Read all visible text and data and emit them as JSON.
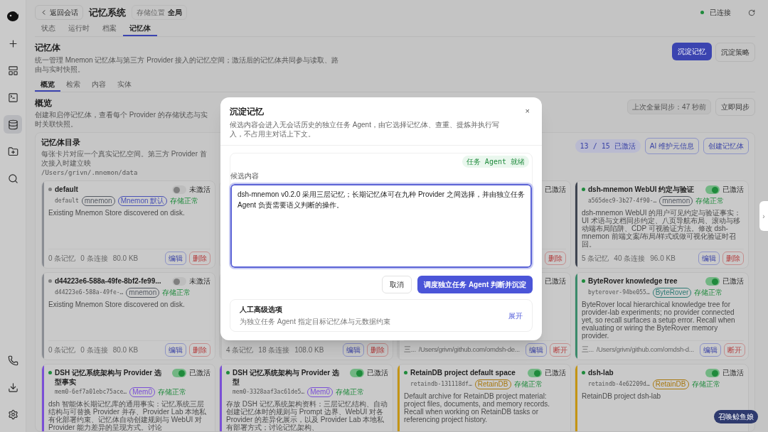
{
  "sidebar": {
    "top_items": [
      {
        "selected": false
      },
      {
        "selected": false
      },
      {
        "selected": false
      },
      {
        "selected": true
      },
      {
        "selected": false
      },
      {
        "selected": false
      }
    ],
    "bottom_items": [
      {
        "selected": false
      },
      {
        "selected": false
      },
      {
        "selected": false
      }
    ]
  },
  "header": {
    "back": "返回会话",
    "title": "记忆系统",
    "scope_label": "存储位置",
    "scope_value": "全局",
    "connection": "已连接",
    "connected": true
  },
  "tabs": [
    {
      "label": "状态",
      "selected": false
    },
    {
      "label": "运行时",
      "selected": false
    },
    {
      "label": "档案",
      "selected": false
    },
    {
      "label": "记忆体",
      "selected": true
    }
  ],
  "section": {
    "title": "记忆体",
    "description": "统一管理 Mnemon 记忆体与第三方 Provider 接入的记忆空间；激活后的记忆体共同参与读取、路由与实时快照。",
    "primary_button": "沉淀记忆",
    "secondary_button": "沉淀策略"
  },
  "subtabs": [
    {
      "label": "概览",
      "selected": true
    },
    {
      "label": "检索",
      "selected": false
    },
    {
      "label": "内容",
      "selected": false
    },
    {
      "label": "实体",
      "selected": false
    }
  ],
  "overview": {
    "title": "概览",
    "description": "创建和启停记忆体，查看每个 Provider 的存储状态与实时关联快照。",
    "last_sync": "上次全量同步：47 秒前",
    "sync_button": "立即同步"
  },
  "catalog": {
    "title": "记忆体目录",
    "description": "每张卡片对应一个真实记忆空间。第三方 Provider 首次接入时建立映",
    "path": "/Users/grivn/.mnemon/data",
    "active_count": "13 / 15 已激活",
    "ai_button": "AI 维护元信息",
    "create_button": "创建记忆体"
  },
  "cards": [
    {
      "color": "#8a8d93",
      "active": false,
      "status_label": "未激活",
      "title": "default",
      "id": "default",
      "tags": [
        {
          "label": "mnemon",
          "color": "#555a63"
        },
        {
          "label": "Mnemon 默认",
          "color": "#4a52b5"
        }
      ],
      "storage": "存储正常",
      "description": "Existing Mnemon Store discovered on disk.",
      "stats": [
        "0 条记忆",
        "0 条连接",
        "80.0 KB"
      ],
      "actions": [
        {
          "label": "编辑",
          "kind": "edit"
        },
        {
          "label": "删除",
          "kind": "danger"
        }
      ]
    },
    {
      "status_label": "已激活",
      "actions": [
        {
          "label": "删除",
          "kind": "danger"
        }
      ]
    },
    {
      "color": "#3e4450",
      "active": true,
      "status_label": "已激活",
      "title": "dsh-mnemon WebUI 约定与验证",
      "id": "a565dec9-3b27-4f90-…",
      "tags": [
        {
          "label": "mnemon",
          "color": "#555a63"
        }
      ],
      "storage": "存储正常",
      "description": "dsh-mnemon WebUI 的用户可见约定与验证事实：UI 术语与文档同步约定、八页导航布局、滚动与移动端布局陷阱、CDP 可视验证方法。修改 dsh-mnemon 前端文案/布局/样式或做可视化验证时召回。",
      "stats": [
        "5 条记忆",
        "40 条连接",
        "96.0 KB"
      ],
      "actions": [
        {
          "label": "编辑",
          "kind": "edit"
        },
        {
          "label": "删除",
          "kind": "danger"
        }
      ]
    },
    {
      "color": "#8a8d93",
      "active": false,
      "status_label": "未激活",
      "title": "d44223e6-588a-49fe-8bf2-fe99...",
      "id": "d44223e6-588a-49fe-…",
      "tags": [
        {
          "label": "mnemon",
          "color": "#555a63"
        }
      ],
      "storage": "存储正常",
      "description": "Existing Mnemon Store discovered on disk.",
      "stats": [
        "0 条记忆",
        "0 条连接",
        "80.0 KB"
      ],
      "actions": [
        {
          "label": "编辑",
          "kind": "edit"
        },
        {
          "label": "删除",
          "kind": "danger"
        }
      ]
    },
    {
      "stats": [
        "4 条记忆",
        "18 条连接",
        "108.0 KB"
      ],
      "actions": [
        {
          "label": "编辑",
          "kind": "edit"
        },
        {
          "label": "删除",
          "kind": "danger"
        }
      ]
    },
    {
      "status_label": "已激活",
      "path": [
        "三...",
        "/Users/grivn/github.com/omdsh-de..."
      ],
      "actions": [
        {
          "label": "编辑",
          "kind": "edit"
        },
        {
          "label": "断开",
          "kind": "danger"
        }
      ]
    },
    {
      "color": "#3a8a6a",
      "active": true,
      "status_label": "已激活",
      "title": "ByteRover knowledge tree",
      "id": "byterover-94be055…",
      "tags": [
        {
          "label": "ByteRover",
          "color": "#2f7a75"
        }
      ],
      "storage": "存储正常",
      "description": "ByteRover local hierarchical knowledge tree for provider-lab experiments; no provider connected yet, so recall surfaces a setup error. Recall when evaluating or wiring the ByteRover memory provider.",
      "path": [
        "三...",
        "/Users/grivn/github.com/omdsh-d..."
      ],
      "actions": [
        {
          "label": "编辑",
          "kind": "edit"
        },
        {
          "label": "断开",
          "kind": "danger"
        }
      ]
    },
    {
      "color": "#7a4fd6",
      "active": true,
      "status_label": "已激活",
      "title": "DSH 记忆系统架构与 Provider 选型事实",
      "id": "mem0-6ef7a01ebc75ace…",
      "tags": [
        {
          "label": "Mem0",
          "color": "#7a4fd6"
        }
      ],
      "storage": "存储正常",
      "description": "dsh 智能体长期记忆库的通用事实：记忆系统三层结构与可替换 Provider 并存、Provider Lab 本地私有化部署约束、记忆体自动创建规则与 WebUI 对 Provider 能力差异的呈现方式。讨论"
    },
    {
      "color": "#7a4fd6",
      "active": true,
      "status_label": "已激活",
      "title": "DSH 记忆系统架构与 Provider 选型",
      "id": "mem0-3328aaf3ac61de5…",
      "tags": [
        {
          "label": "Mem0",
          "color": "#7a4fd6"
        }
      ],
      "storage": "存储正常",
      "description": "存放 DSH 记忆系统架构资料：三层记忆结构、自动创建记忆体时的规则与 Prompt 边界、WebUI 对各 Provider 的差异化展示，以及 Provider Lab 本地私有部署方式；讨论记忆架构、"
    },
    {
      "color": "#c49414",
      "active": true,
      "status_label": "已激活",
      "title": "RetainDB project default space",
      "id": "retaindb-131118df…",
      "tags": [
        {
          "label": "RetainDB",
          "color": "#a8780f"
        }
      ],
      "storage": "存储正常",
      "description": "Default archive for RetainDB project material: project files, documents, and memory records. Recall when working on RetainDB tasks or referencing project history."
    },
    {
      "color": "#c49414",
      "active": true,
      "status_label": "已激活",
      "title": "dsh-lab",
      "id": "retaindb-4e62209d…",
      "tags": [
        {
          "label": "RetainDB",
          "color": "#a8780f"
        }
      ],
      "storage": "存储正常",
      "description": "RetainDB project dsh-lab"
    }
  ],
  "side_handle": "›",
  "mascot_button": "召唤鲸鱼娘",
  "dialog": {
    "title": "沉淀记忆",
    "description": "候选内容会进入无会话历史的独立任务 Agent，由它选择记忆体、查重、提炼并执行写入，不占用主对话上下文。",
    "close": "×",
    "agent_status": "任务 Agent 就绪",
    "field_label": "候选内容",
    "value": "dsh-mnemon v0.2.0 采用三层记忆；长期记忆体可在九种 Provider 之间选择，并由独立任务 Agent 负责需要语义判断的操作。",
    "cancel": "取消",
    "submit": "调度独立任务 Agent 判断并沉淀",
    "advanced_title": "人工高级选项",
    "advanced_description": "为独立任务 Agent 指定目标记忆体与元数据约束",
    "expand": "展开"
  }
}
